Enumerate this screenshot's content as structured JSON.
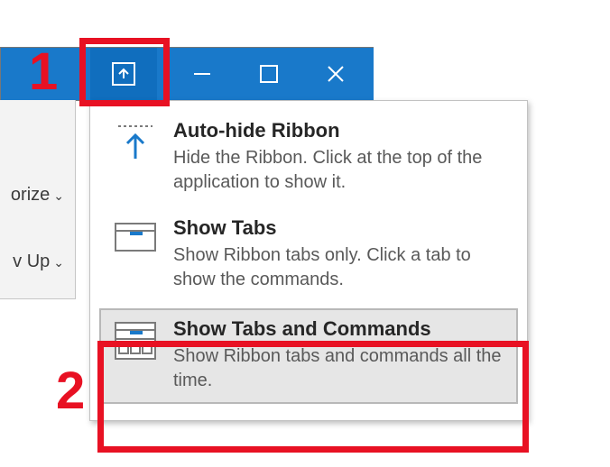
{
  "ribbon": {
    "items": [
      {
        "label": "orize"
      },
      {
        "label": "v Up"
      }
    ]
  },
  "titlebar": {
    "ribbon_options_tooltip": "Ribbon Display Options",
    "minimize_tooltip": "Minimize",
    "maximize_tooltip": "Maximize",
    "close_tooltip": "Close"
  },
  "menu": {
    "items": [
      {
        "title": "Auto-hide Ribbon",
        "desc": "Hide the Ribbon. Click at the top of the application to show it."
      },
      {
        "title": "Show Tabs",
        "desc": "Show Ribbon tabs only. Click a tab to show the commands."
      },
      {
        "title": "Show Tabs and Commands",
        "desc": "Show Ribbon tabs and commands all the time."
      }
    ]
  },
  "annotations": {
    "one": "1",
    "two": "2"
  }
}
